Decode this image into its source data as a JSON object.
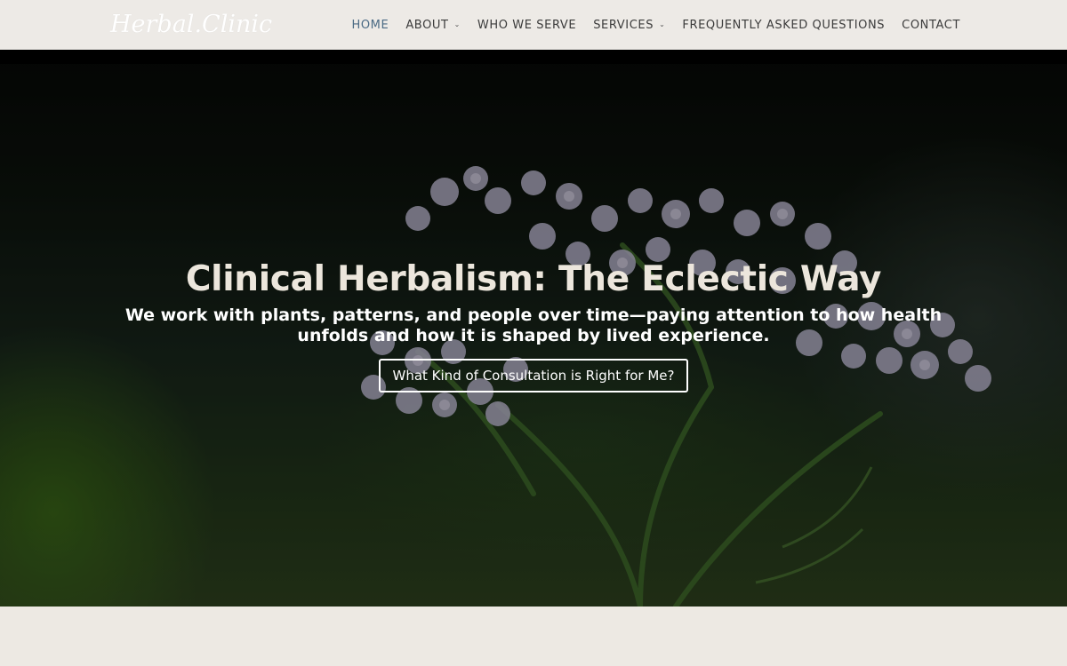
{
  "header": {
    "logo_text": "Herbal.Clinic",
    "nav": [
      {
        "label": "HOME",
        "active": true,
        "dropdown": false
      },
      {
        "label": "ABOUT",
        "active": false,
        "dropdown": true
      },
      {
        "label": "WHO WE SERVE",
        "active": false,
        "dropdown": false
      },
      {
        "label": "SERVICES",
        "active": false,
        "dropdown": true
      },
      {
        "label": "FREQUENTLY ASKED QUESTIONS",
        "active": false,
        "dropdown": false
      },
      {
        "label": "CONTACT",
        "active": false,
        "dropdown": false
      }
    ],
    "chevron_icon": "chevron-down-icon"
  },
  "hero": {
    "title": "Clinical Herbalism: The Eclectic Way",
    "subtitle": "We work with plants, patterns, and people over time—paying attention to how health unfolds and how it is shaped by lived experience.",
    "button_label": "What Kind of Consultation is Right for Me?",
    "background_image": "yarrow-flowers-photo"
  },
  "colors": {
    "header_bg": "#edeae6",
    "nav_text": "#3b3b3b",
    "nav_active": "#4a6a84",
    "hero_title": "#ece6dc",
    "page_bg": "#ede9e3"
  }
}
